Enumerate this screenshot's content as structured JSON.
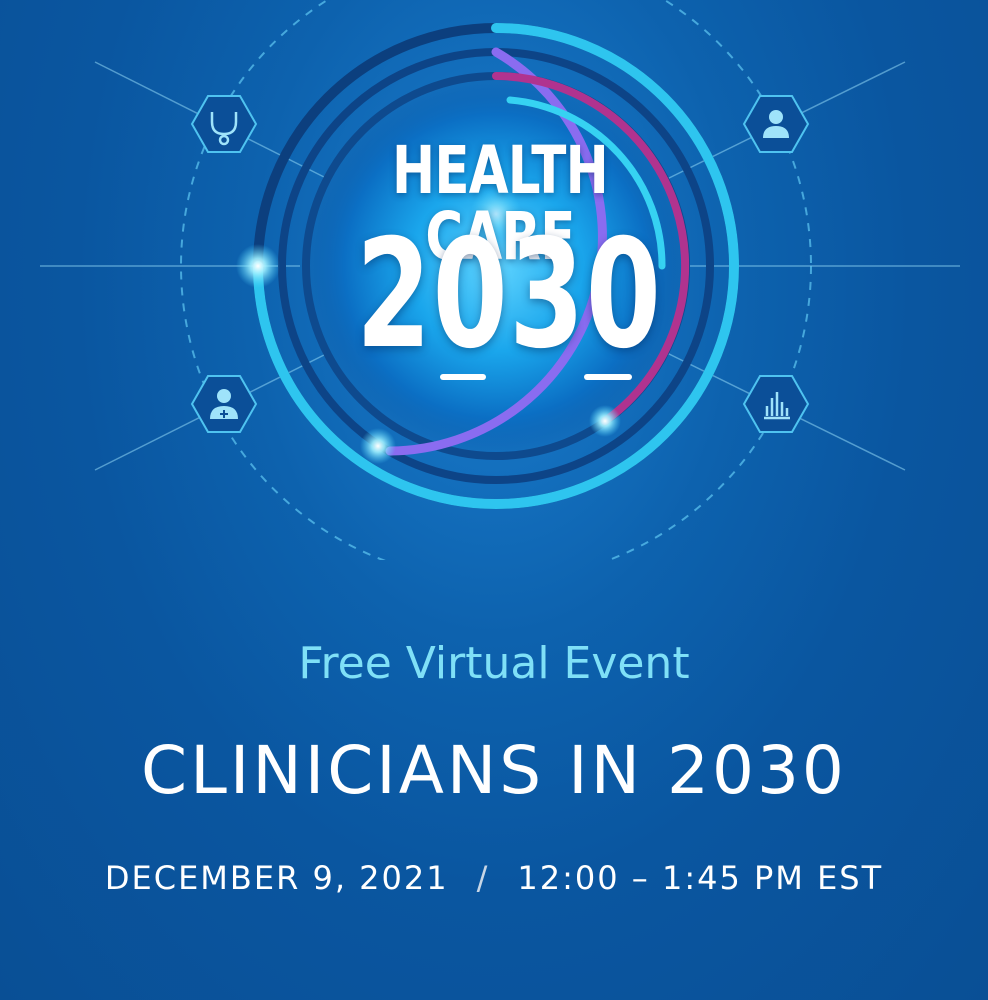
{
  "emblem": {
    "line1": "HEALTH CARE",
    "line2": "2030",
    "icons": [
      "stethoscope-icon",
      "user-icon",
      "doctor-icon",
      "bar-chart-icon"
    ]
  },
  "event": {
    "subtitle": "Free Virtual Event",
    "title": "CLINICIANS IN 2030",
    "date": "DECEMBER 9, 2021",
    "separator": "/",
    "time": "12:00 – 1:45 PM EST"
  },
  "colors": {
    "background": "#0a56a0",
    "accent_cyan": "#2ec5ef",
    "accent_purple": "#8a6cf0",
    "accent_magenta": "#b0338f",
    "subtitle": "#7fe0f7"
  }
}
